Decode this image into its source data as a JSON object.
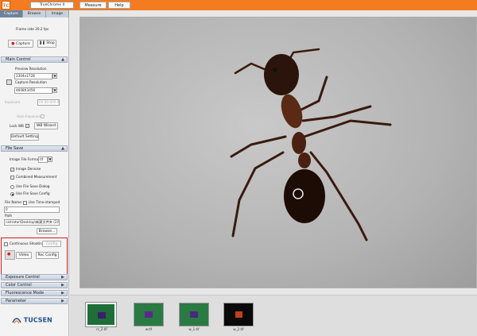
{
  "titlebar": {
    "logo_text": "TC",
    "camera": "TrueChrome II",
    "menus": [
      "Measure",
      "Help"
    ]
  },
  "tabs": [
    "Capture",
    "Browse",
    "Image"
  ],
  "capture": {
    "frame_rate": "Frame rate 20.2 fps",
    "capture_label": "Capture",
    "stop_label": "Stop"
  },
  "main_control": {
    "title": "Main Control",
    "preview_resolution_label": "Preview Resolution",
    "preview_resolution": "2304x1728",
    "capture_resolution_label": "Capture Resolution",
    "capture_resolution": "4608X3456",
    "exposure_label": "Exposure",
    "exposure_time": "00:00:000.0",
    "auto_exposure_label": "Auto Exposure",
    "lock_wb_label": "Lock WB",
    "wb_wizard_label": "WB Wizard",
    "default_setting_label": "Default Setting"
  },
  "file_save": {
    "title": "File Save",
    "format_label": "Image File Format",
    "format": "tif",
    "image_denoise_label": "Image Denoise",
    "combined_measurement_label": "Combined Measurement",
    "use_dialog_label": "Use File Save Dialog",
    "use_config_label": "Use File Save Config",
    "file_name_label": "File Name:",
    "use_time_stamped_label": "Use Time-stamped",
    "file_name": "0",
    "path_label": "Path",
    "path": "nistrator\\Desktop\\新建文件夹 (2)\\",
    "browse_label": "Browse..."
  },
  "continuous": {
    "continuous_label": "Continuous Shooting",
    "config_label": "Config",
    "video_label": "Video",
    "rec_config_label": "Rec Config"
  },
  "collapsed_sections": [
    "Exposure Control",
    "Color Control",
    "Fluorescence Mode",
    "Parameter"
  ],
  "brand": "TUCSEN",
  "thumbnails": [
    {
      "label": "rc_2.tif",
      "selected": true
    },
    {
      "label": "w.tif",
      "selected": false
    },
    {
      "label": "w_1.tif",
      "selected": false
    },
    {
      "label": "w_2.tif",
      "selected": false
    }
  ],
  "colors": {
    "accent": "#f47b20",
    "panel_header": "#6c829e",
    "highlight": "#d42020",
    "brand": "#1f4f8f"
  }
}
